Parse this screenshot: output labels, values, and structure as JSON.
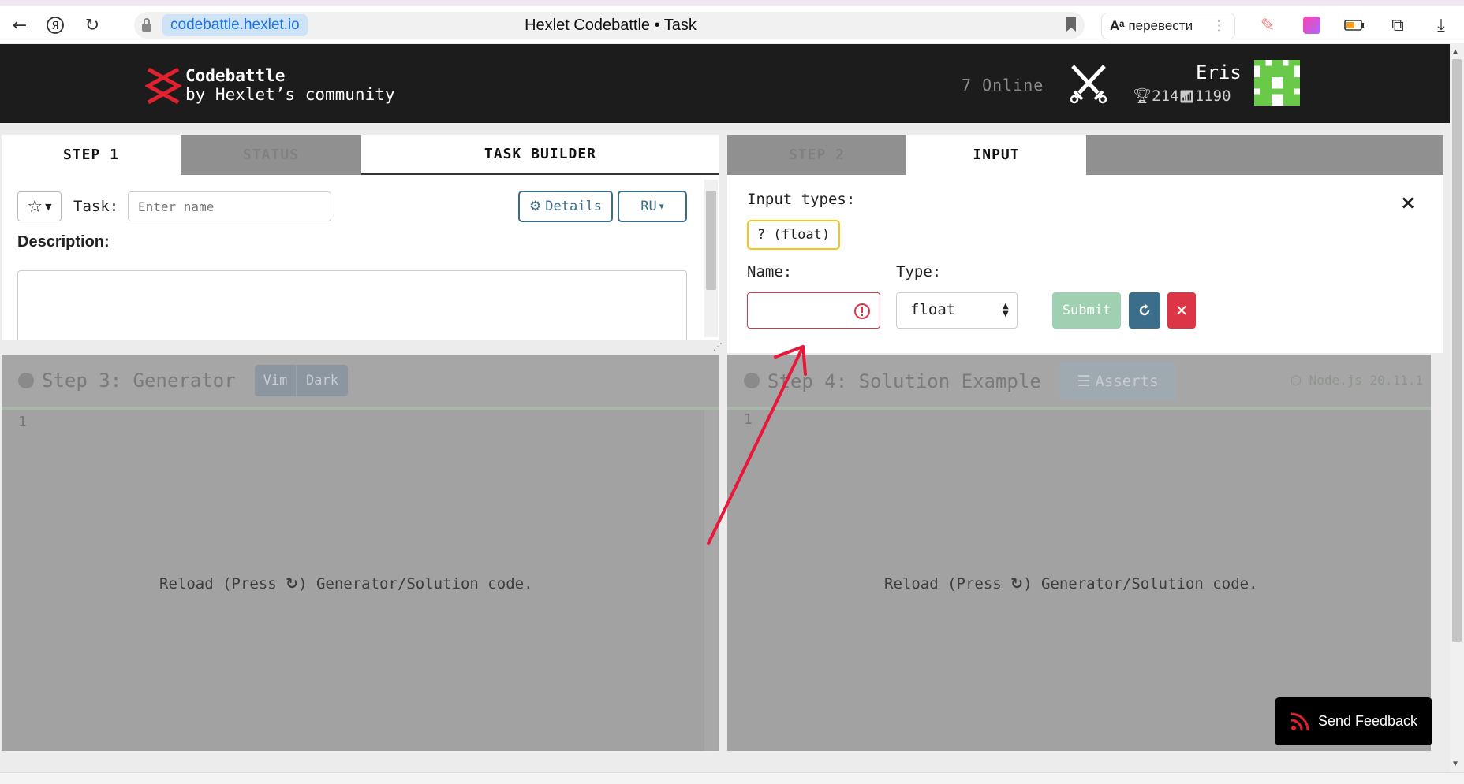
{
  "browser": {
    "url": "codebattle.hexlet.io",
    "title": "Hexlet Codebattle • Task",
    "translate_label": "перевести"
  },
  "header": {
    "brand_title": "Codebattle",
    "brand_subtitle": "by Hexlet’s community",
    "online_text": "7 Online",
    "user_name": "Eris",
    "user_trophies": "214",
    "user_rating": "1190"
  },
  "left_panel": {
    "tabs": [
      {
        "label": "STEP 1"
      },
      {
        "label": "STATUS"
      },
      {
        "label": "TASK BUILDER"
      }
    ],
    "task_label": "Task:",
    "task_placeholder": "Enter name",
    "details_label": "Details",
    "language_label": "RU",
    "description_label": "Description:"
  },
  "right_panel": {
    "tabs": [
      {
        "label": "STEP 2"
      },
      {
        "label": "INPUT"
      }
    ],
    "input_types_label": "Input types:",
    "input_type_badge": "? (float)",
    "name_label": "Name:",
    "type_label": "Type:",
    "type_selected": "float",
    "submit_label": "Submit",
    "close_symbol": "×"
  },
  "generator": {
    "title": "Step 3: Generator",
    "vim_label": "Vim",
    "dark_label": "Dark",
    "line_number": "1",
    "reload_prefix": "Reload (Press",
    "reload_suffix": ") Generator/Solution code."
  },
  "solution": {
    "title": "Step 4: Solution Example",
    "asserts_label": "Asserts",
    "runtime_label": "Node.js 20.11.1",
    "line_number": "1",
    "reload_prefix": "Reload (Press",
    "reload_suffix": ") Generator/Solution code."
  },
  "feedback": {
    "label": "Send Feedback"
  },
  "colors": {
    "header_bg": "#1c1c1c",
    "accent_blue": "#3b6e8a",
    "danger": "#dc3545",
    "badge_border": "#f5c518",
    "submit_bg": "#9fd0b2",
    "annotation_arrow": "#e8183a"
  }
}
